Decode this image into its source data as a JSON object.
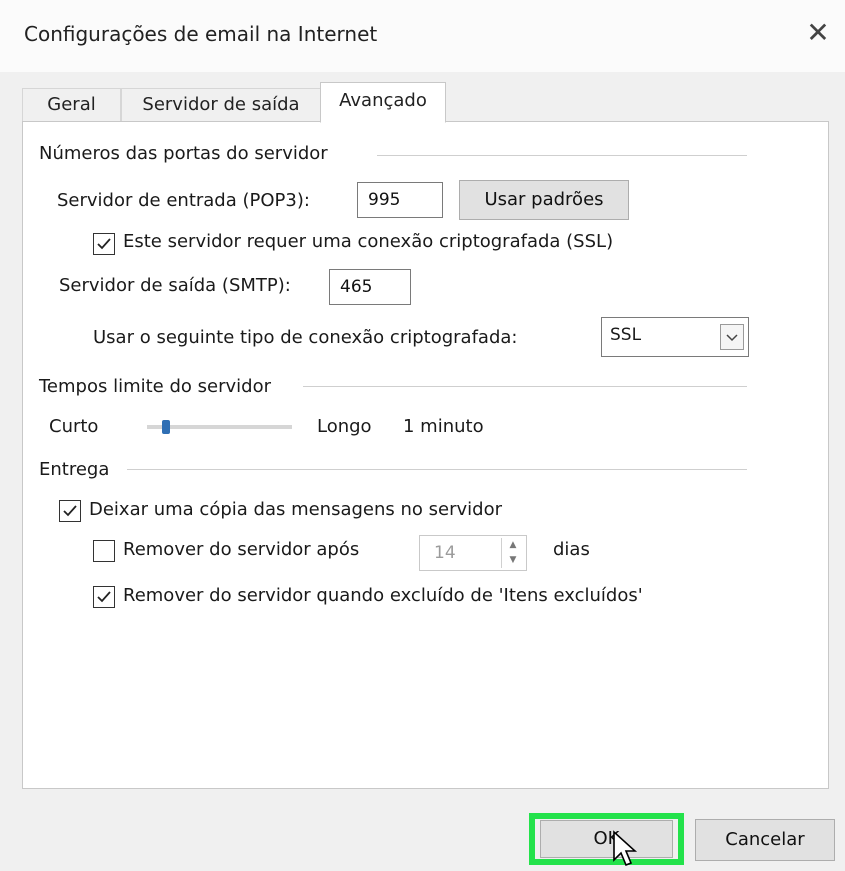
{
  "window": {
    "title": "Configurações de email na Internet",
    "close_glyph": "✕"
  },
  "tabs": [
    {
      "label": "Geral",
      "active": false
    },
    {
      "label": "Servidor de saída",
      "active": false
    },
    {
      "label": "Avançado",
      "active": true
    }
  ],
  "ports_group": {
    "title": "Números das portas do servidor",
    "incoming_label": "Servidor de entrada (POP3):",
    "incoming_value": "995",
    "use_defaults_label": "Usar padrões",
    "ssl_required_label": "Este servidor requer uma conexão criptografada (SSL)",
    "ssl_required_checked": true,
    "outgoing_label": "Servidor de saída (SMTP):",
    "outgoing_value": "465",
    "encryption_label": "Usar o seguinte tipo de conexão criptografada:",
    "encryption_value": "SSL"
  },
  "timeouts_group": {
    "title": "Tempos limite do servidor",
    "short_label": "Curto",
    "long_label": "Longo",
    "value_label": "1 minuto",
    "slider_level": 0.1
  },
  "delivery_group": {
    "title": "Entrega",
    "leave_copy_label": "Deixar uma cópia das mensagens no servidor",
    "leave_copy_checked": true,
    "remove_after_label": "Remover do servidor após",
    "remove_after_checked": false,
    "remove_after_days": "14",
    "days_label": "dias",
    "remove_when_deleted_label": "Remover do servidor quando excluído de 'Itens excluídos'",
    "remove_when_deleted_checked": true
  },
  "footer": {
    "ok_label": "OK",
    "cancel_label": "Cancelar"
  },
  "colors": {
    "highlight": "#23e24b",
    "slider_thumb": "#2f6fb4"
  }
}
